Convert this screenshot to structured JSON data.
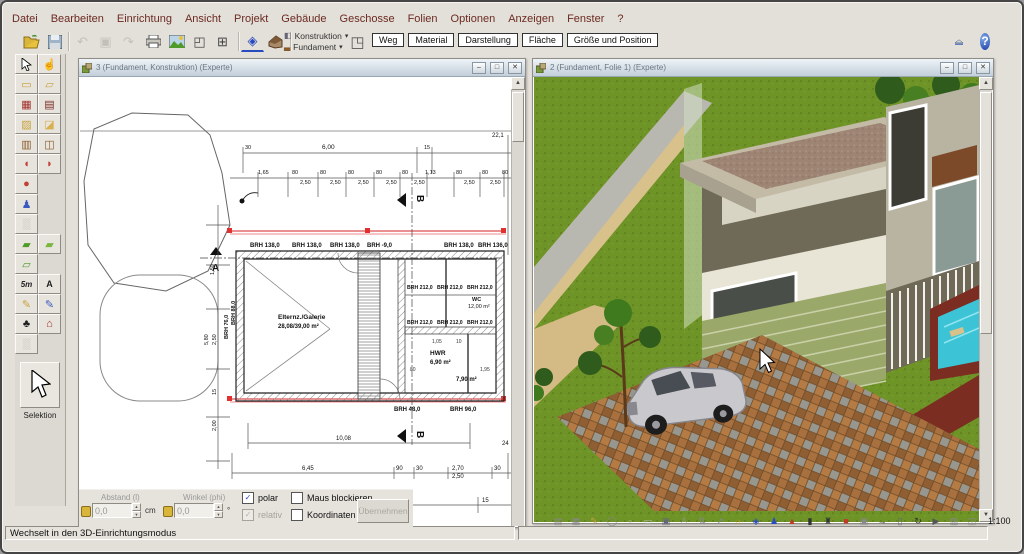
{
  "app": {
    "scale": "1:100"
  },
  "menu": {
    "items": [
      "Datei",
      "Bearbeiten",
      "Einrichtung",
      "Ansicht",
      "Projekt",
      "Gebäude",
      "Geschosse",
      "Folien",
      "Optionen",
      "Anzeigen",
      "Fenster",
      "?"
    ]
  },
  "toolbar": {
    "dropdown1": "Konstruktion",
    "dropdown2": "Fundament",
    "dropdown_arrow": "▾",
    "tabs": [
      "Weg",
      "Material",
      "Darstellung",
      "Fläche",
      "Größe und Position"
    ],
    "icons": {
      "undo": "↶",
      "camera": "▣",
      "redo": "↷",
      "zoom_window": "◰",
      "fit": "⊞",
      "compass": "◈",
      "cube": "▩",
      "move": "✛",
      "flash": "ϟ",
      "layers": "◧",
      "foundation": "▃",
      "mode": "◳"
    }
  },
  "windows": {
    "plan": {
      "title": "3 (Fundament, Konstruktion) (Experte)"
    },
    "view3d": {
      "title": "2 (Fundament, Folie 1) (Experte)"
    },
    "controls": {
      "minimize": "–",
      "maximize": "□",
      "close": "✕"
    }
  },
  "left_toolbar": {
    "selektion": "Selektion",
    "buttons": [
      {
        "name": "hand-tool",
        "glyph": "☝"
      },
      {
        "name": "wall-tool",
        "glyph": "▭"
      },
      {
        "name": "wall-2-tool",
        "glyph": "▱"
      },
      {
        "name": "window-tool",
        "glyph": "▦"
      },
      {
        "name": "door-tool",
        "glyph": "▤"
      },
      {
        "name": "stairs-tool",
        "glyph": "▨"
      },
      {
        "name": "ceiling-tool",
        "glyph": "◪"
      },
      {
        "name": "furniture-tool",
        "glyph": "▥"
      },
      {
        "name": "cabinet-tool",
        "glyph": "◫"
      },
      {
        "name": "sofa-tool",
        "glyph": "◖"
      },
      {
        "name": "armchair-tool",
        "glyph": "◗"
      },
      {
        "name": "chair-tool",
        "glyph": "●"
      },
      {
        "name": "office-chair-tool",
        "glyph": "♟"
      },
      {
        "name": "disabled-tool",
        "glyph": "▒"
      },
      {
        "name": "terrain-tool",
        "glyph": "▰"
      },
      {
        "name": "terrain-2-tool",
        "glyph": "▰"
      },
      {
        "name": "area-tool",
        "glyph": "▱"
      },
      {
        "name": "dimension-tool",
        "glyph": "5m"
      },
      {
        "name": "text-tool",
        "glyph": "A"
      },
      {
        "name": "paint-tool",
        "glyph": "✎"
      },
      {
        "name": "pen-tool",
        "glyph": "✎"
      },
      {
        "name": "plants-tool",
        "glyph": "♣"
      },
      {
        "name": "building-tool",
        "glyph": "⌂"
      },
      {
        "name": "disabled-2-tool",
        "glyph": "▒"
      }
    ]
  },
  "plan": {
    "brh_top": [
      "BRH 138,0",
      "BRH 138,0",
      "BRH 138,0",
      "BRH -9,0",
      "BRH 138,0",
      "BRH 136,0"
    ],
    "brh_right1": [
      "BRH 212,0",
      "BRH 212,0",
      "BRH 212,0"
    ],
    "brh_right2": [
      "BRH 212,0",
      "BRH 212,0",
      "BRH 212,0"
    ],
    "brh_bottom": [
      "BRH 48,0",
      "BRH 96,0"
    ],
    "brh_left1": "BRH 76,0",
    "brh_left2": "BRH 88,0",
    "room1_name": "Elternz./Galerie",
    "room1_area": "28,08/39,00 m²",
    "room2_name": "WC",
    "room2_area": "12,00 m²",
    "room3_name": "HWR",
    "room3_area": "6,90 m²",
    "room4_area": "7,90 m²",
    "room_dims": [
      "1,05",
      "10",
      "80",
      "1,95"
    ],
    "dim_600": "6,00",
    "dim_30": "30",
    "dim_15": "15",
    "dim_221": "22,1",
    "dims_top1": [
      "1,65",
      "80",
      "80",
      "80",
      "80",
      "80",
      "1,13",
      "80",
      "80",
      "80"
    ],
    "dims_top2": [
      "2,50",
      "2,50",
      "2,50",
      "2,50",
      "2,50",
      "2,50",
      "2,50"
    ],
    "vdims": [
      "1,50",
      "5,80",
      "2,50",
      "15",
      "2,00"
    ],
    "bdims": {
      "d1": "10,08",
      "d2": "6,45",
      "d3": "90",
      "d4": "30",
      "d5": "2,70",
      "d6": "2,50",
      "d7": "30",
      "d8": "24",
      "d9": "6,00",
      "d10": "15",
      "d11": "30"
    },
    "section_a": "A",
    "section_b": "B"
  },
  "coord": {
    "abstand_label": "Abstand (l)",
    "abstand_value": "0,0",
    "abstand_unit": "cm",
    "winkel_label": "Winkel (phi)",
    "winkel_value": "0,0",
    "winkel_unit": "°",
    "polar_label": "polar",
    "relativ_label": "relativ",
    "maus_label": "Maus blockieren",
    "koord_label": "Koordinaten an der Maus",
    "apply_label": "Übernehmen",
    "check_glyph": "✓"
  },
  "bottom_toolbar": {
    "icons": [
      {
        "name": "list-icon",
        "glyph": "▤"
      },
      {
        "name": "grid-icon",
        "glyph": "▦"
      },
      {
        "name": "pencil-icon",
        "glyph": "✎"
      },
      {
        "name": "circle-icon",
        "glyph": "◯"
      },
      {
        "name": "small-box-icon",
        "glyph": "▫"
      },
      {
        "name": "box-icon",
        "glyph": "▭"
      },
      {
        "name": "monitor-icon",
        "glyph": "▣"
      },
      {
        "name": "figure-icon",
        "glyph": "♙"
      },
      {
        "name": "arrows-icon",
        "glyph": "⇅"
      },
      {
        "name": "arrow-ne-icon",
        "glyph": "↗"
      },
      {
        "name": "sun-icon",
        "glyph": "☼"
      },
      {
        "name": "compass-icon",
        "glyph": "◈"
      },
      {
        "name": "person-icon",
        "glyph": "♟"
      },
      {
        "name": "roof-icon",
        "glyph": "▲"
      },
      {
        "name": "column-icon",
        "glyph": "▮"
      },
      {
        "name": "tower-icon",
        "glyph": "♜"
      },
      {
        "name": "red-cube-icon",
        "glyph": "■"
      },
      {
        "name": "window-icon",
        "glyph": "▣"
      },
      {
        "name": "arrow-right-icon",
        "glyph": "→"
      },
      {
        "name": "ruler-icon",
        "glyph": "▯"
      },
      {
        "name": "refresh-icon",
        "glyph": "↻"
      },
      {
        "name": "play-icon",
        "glyph": "▶"
      },
      {
        "name": "hatch-icon",
        "glyph": "▨"
      },
      {
        "name": "panel-icon",
        "glyph": "◫"
      }
    ]
  },
  "status": {
    "text": "Wechselt in den 3D-Einrichtungsmodus"
  },
  "colors": {
    "grass": "#6e9327",
    "path": "#b9b8b0",
    "sand": "#d9c18c",
    "roof": "#9d8473",
    "roof_edge": "#c3bba6",
    "garage": "#9aa86a",
    "brick": "#a8703e",
    "walkway": "#7c2d22",
    "pool": "#3cc4d6",
    "car": "#c9c9cd",
    "face": "#b9b3a2",
    "interior": "#6f6a58"
  }
}
